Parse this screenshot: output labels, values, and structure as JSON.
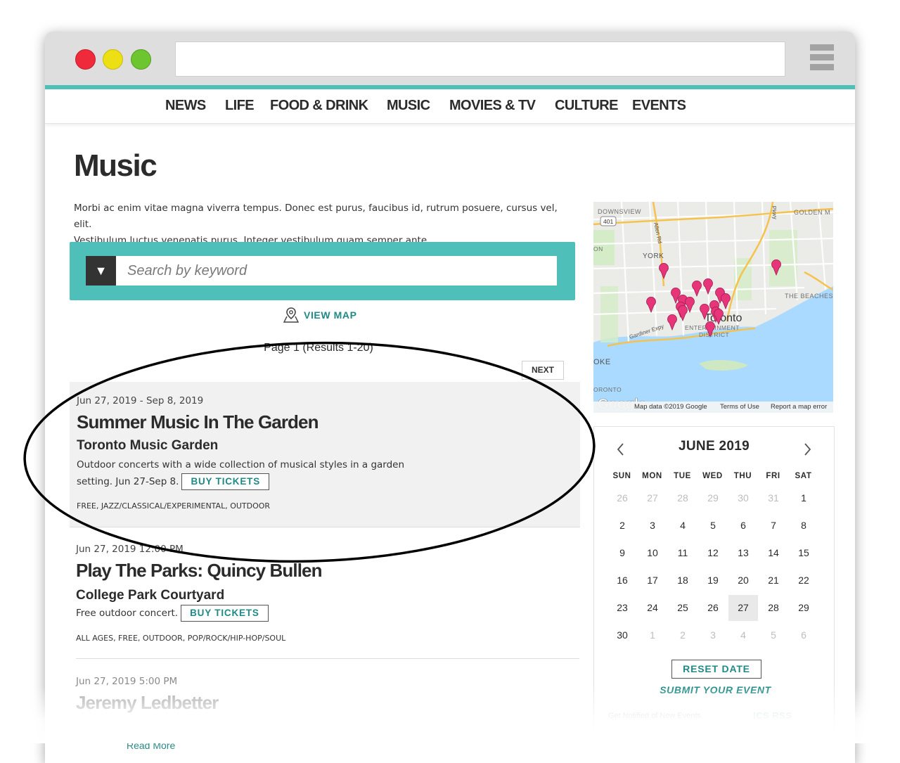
{
  "nav": {
    "items": [
      "NEWS",
      "LIFE",
      "FOOD & DRINK",
      "MUSIC",
      "MOVIES & TV",
      "CULTURE",
      "EVENTS"
    ]
  },
  "page": {
    "title": "Music",
    "intro_line1": "Morbi ac enim vitae magna viverra tempus. Donec est purus, faucibus id, rutrum posuere, cursus vel, elit.",
    "intro_line2": "Vestibulum luctus venenatis purus. Integer vestibulum quam semper ante."
  },
  "search": {
    "dropdown_glyph": "▼",
    "placeholder": "Search by keyword"
  },
  "view_map_label": "VIEW MAP",
  "pagination": {
    "info": "Page 1 (Results 1-20)",
    "next_label": "NEXT"
  },
  "events": [
    {
      "date": "Jun 27, 2019 - Sep 8, 2019",
      "title": "Summer Music In The Garden",
      "venue": "Toronto Music Garden",
      "desc_line1": "Outdoor concerts with a wide collection of musical styles in a garden",
      "desc_line2": "setting. Jun 27-Sep 8.",
      "buy_label": "BUY TICKETS",
      "tags": "FREE, JAZZ/CLASSICAL/EXPERIMENTAL, OUTDOOR"
    },
    {
      "date": "Jun 27, 2019 12:00 PM",
      "title": "Play The Parks: Quincy Bullen",
      "venue": "College Park Courtyard",
      "desc_line1": "Free outdoor concert.",
      "buy_label": "BUY TICKETS",
      "tags": "ALL AGES, FREE, OUTDOOR, POP/ROCK/HIP-HOP/SOUL"
    },
    {
      "date": "Jun 27, 2019 5:00 PM",
      "title": "Jeremy Ledbetter",
      "read_more": "Read More"
    }
  ],
  "map": {
    "labels": [
      "DOWNSVIEW",
      "GOLDEN M",
      "YORK",
      "THE BEACHES",
      "ENTERTAINMENT",
      "DISTRICT",
      "Toronto",
      "Gardiner Expy",
      "Allen Rd",
      "Pkwy",
      "OKE",
      "ORONTO",
      "ON",
      "401"
    ],
    "google": "Google",
    "footer_data": "Map data ©2019 Google",
    "footer_terms": "Terms of Use",
    "footer_report": "Report a map error",
    "pin_color": "#e8357a"
  },
  "calendar": {
    "month": "JUNE 2019",
    "weekdays": [
      "SUN",
      "MON",
      "TUE",
      "WED",
      "THU",
      "FRI",
      "SAT"
    ],
    "days": [
      [
        "26",
        "27",
        "28",
        "29",
        "30",
        "31",
        "1"
      ],
      [
        "2",
        "3",
        "4",
        "5",
        "6",
        "7",
        "8"
      ],
      [
        "9",
        "10",
        "11",
        "12",
        "13",
        "14",
        "15"
      ],
      [
        "16",
        "17",
        "18",
        "19",
        "20",
        "21",
        "22"
      ],
      [
        "23",
        "24",
        "25",
        "26",
        "27",
        "28",
        "29"
      ],
      [
        "30",
        "1",
        "2",
        "3",
        "4",
        "5",
        "6"
      ]
    ],
    "selected": "27",
    "reset_label": "RESET DATE",
    "submit_label": "SUBMIT YOUR EVENT",
    "notify_text": "Get Notified of New Events",
    "feed_links": "ICS  RSS"
  },
  "colors": {
    "accent": "#4fbfba",
    "link": "#1f8a86",
    "pin": "#e8357a"
  }
}
